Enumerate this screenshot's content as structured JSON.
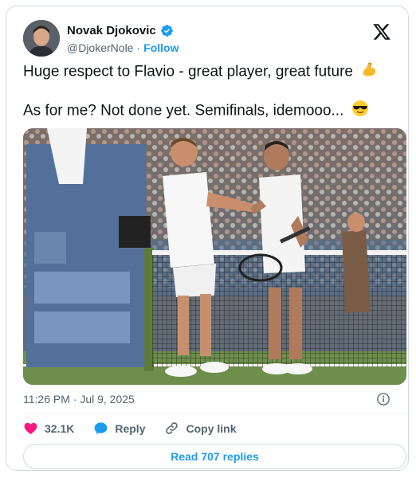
{
  "tweet": {
    "author_name": "Novak Djokovic",
    "handle": "@DjokerNole",
    "separator": "·",
    "follow_label": "Follow",
    "line1": "Huge respect to Flavio - great player, great future",
    "line2": "As for me? Not done yet. Semifinals, idemooo...",
    "line1_emoji": "flexed-biceps",
    "line2_emoji": "sunglasses-face",
    "timestamp": "11:26 PM · Jul 9, 2025"
  },
  "actions": {
    "likes": "32.1K",
    "reply_label": "Reply",
    "copy_link_label": "Copy link",
    "read_replies_label": "Read 707 replies"
  },
  "colors": {
    "accent": "#1d9bf0",
    "like": "#f91880",
    "text": "#0f1419",
    "muted": "#536471"
  }
}
